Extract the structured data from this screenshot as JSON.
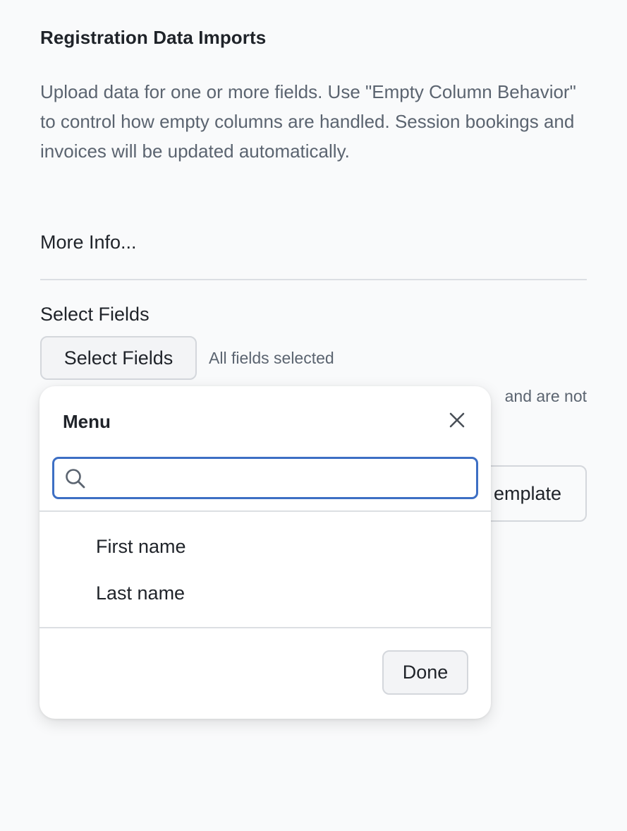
{
  "header": {
    "title": "Registration Data Imports"
  },
  "intro": {
    "description": "Upload data for one or more fields. Use \"Empty Column Behavior\" to control how empty columns are handled. Session bookings and invoices will be updated automatically.",
    "more_info_link": "More Info..."
  },
  "select_fields": {
    "label": "Select Fields",
    "button_label": "Select Fields",
    "status": "All fields selected",
    "obscured_note": "and are not",
    "obscured_button_label": "emplate"
  },
  "menu": {
    "title": "Menu",
    "search": {
      "value": "",
      "placeholder": ""
    },
    "items": [
      {
        "label": "First name"
      },
      {
        "label": "Last name"
      }
    ],
    "done_label": "Done"
  },
  "colors": {
    "background": "#f9fafb",
    "accent_focus": "#3d6fc4",
    "muted_text": "#5b6470",
    "border": "#d4d7dc"
  },
  "icons": {
    "close": "close-icon",
    "search": "search-icon"
  }
}
